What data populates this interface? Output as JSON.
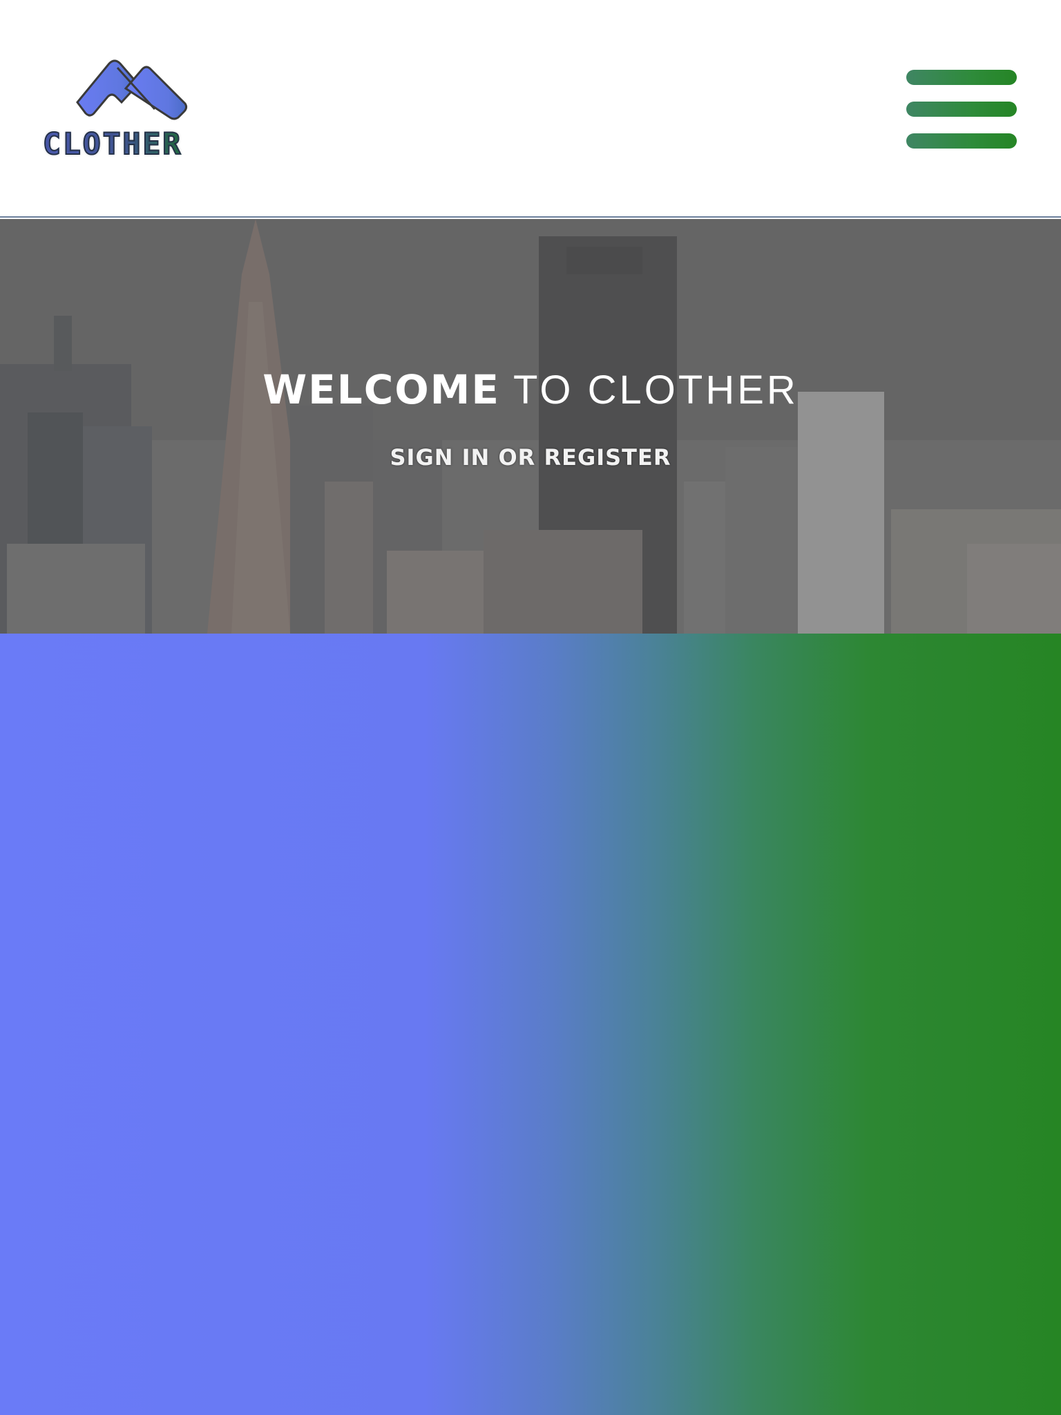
{
  "header": {
    "logo": {
      "wordmark": "CLOTHER",
      "icon": "clother-logo-icon"
    },
    "menu": {
      "icon": "hamburger-menu-icon",
      "bar_color_start": "#3f8663",
      "bar_color_end": "#258525"
    }
  },
  "hero": {
    "background": "city-skyline-photo",
    "title_bold": "WELCOME",
    "title_light": " TO CLOTHER",
    "cta": "SIGN IN OR REGISTER"
  },
  "gradient_section": {
    "color_start": "#6a7bf7",
    "color_end": "#268524"
  }
}
